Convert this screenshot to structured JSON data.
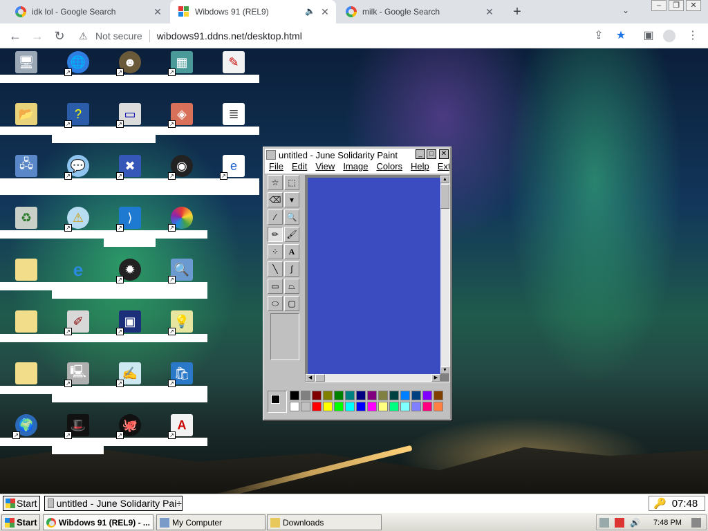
{
  "browser": {
    "tabs": [
      {
        "title": "idk lol - Google Search",
        "favicon": "google-icon",
        "active": false
      },
      {
        "title": "Wibdows 91 (REL9)",
        "favicon": "windows91-icon",
        "active": true
      },
      {
        "title": "milk - Google Search",
        "favicon": "google-icon",
        "active": false
      }
    ],
    "address": {
      "security_label": "Not secure",
      "url": "wibdows91.ddns.net/desktop.html"
    }
  },
  "paint_window": {
    "title": "untitled - June Solidarity Paint",
    "menus": [
      "File",
      "Edit",
      "View",
      "Image",
      "Colors",
      "Help",
      "Extras"
    ],
    "canvas_color": "#3b4cc0",
    "foreground_color": "#000000",
    "background_color": "#ffffff",
    "palette": [
      "#000000",
      "#808080",
      "#800000",
      "#808000",
      "#008000",
      "#008080",
      "#000080",
      "#800080",
      "#808040",
      "#004040",
      "#0080ff",
      "#004080",
      "#8000ff",
      "#804000",
      "#ffffff",
      "#c0c0c0",
      "#ff0000",
      "#ffff00",
      "#00ff00",
      "#00ffff",
      "#0000ff",
      "#ff00ff",
      "#ffff80",
      "#00ff80",
      "#80ffff",
      "#8080ff",
      "#ff0080",
      "#ff8040"
    ]
  },
  "inner_taskbar": {
    "start_label": "Start",
    "task_label": "untitled - June Solidarity Pai÷",
    "clock": "07:48"
  },
  "host_taskbar": {
    "start_label": "Start",
    "tasks": [
      "Wibdows 91 (REL9) - ...",
      "My Computer",
      "Downloads"
    ],
    "clock": "7:48 PM"
  }
}
